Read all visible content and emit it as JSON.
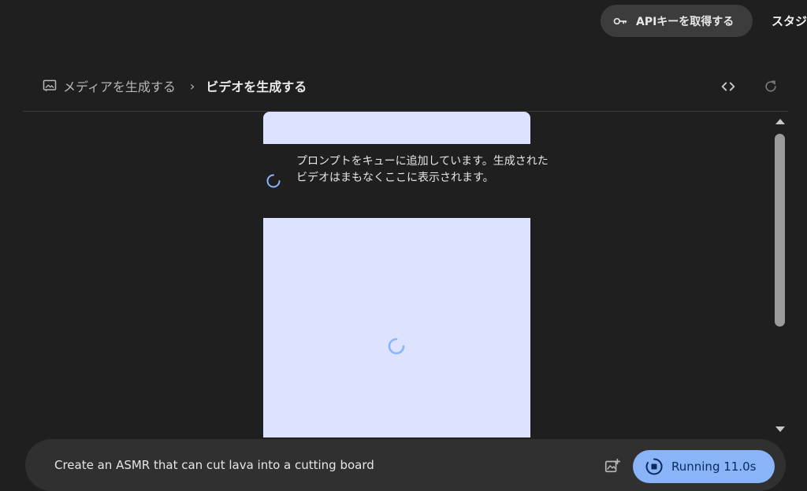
{
  "header": {
    "api_key_label": "APIキーを取得する",
    "api_key_icon": "key-icon",
    "studio_label": "スタジ"
  },
  "breadcrumb": {
    "parent_icon": "image-frame-icon",
    "parent": "メディアを生成する",
    "separator": "›",
    "current": "ビデオを生成する"
  },
  "tools": {
    "code_icon": "code-icon",
    "refresh_icon": "refresh-icon"
  },
  "video_panel": {
    "status_message": "プロンプトをキューに追加しています。生成されたビデオはまもなくここに表示されます。",
    "background_color": "#dde3ff"
  },
  "prompt_bar": {
    "prompt_text": "Create an ASMR that can cut lava into a cutting board",
    "media_icon": "add-image-icon",
    "run_label": "Running 11.0s",
    "run_icon": "stop-icon",
    "accent_color": "#8ab4f8"
  }
}
